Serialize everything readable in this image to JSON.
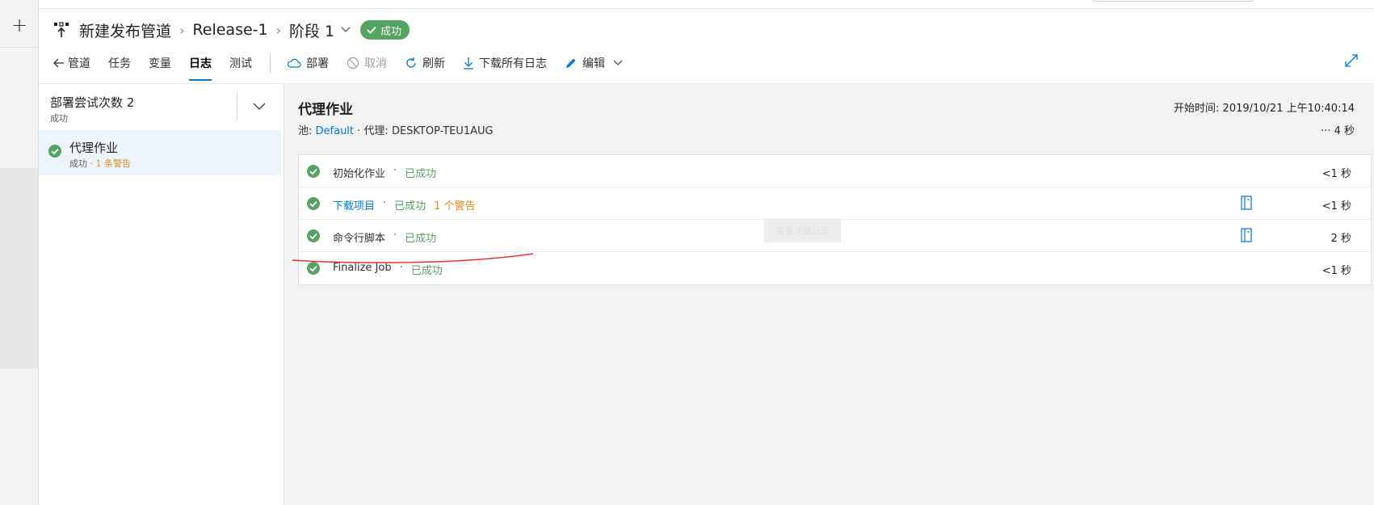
{
  "header": {
    "pipeline": "新建发布管道",
    "release": "Release-1",
    "stage": "阶段 1",
    "status": "成功"
  },
  "tabs": [
    "管道",
    "任务",
    "变量",
    "日志",
    "测试"
  ],
  "active_tab": "日志",
  "tools": {
    "deploy": "部署",
    "cancel": "取消",
    "refresh": "刷新",
    "download_logs": "下载所有日志",
    "edit": "编辑"
  },
  "left": {
    "attempt_title": "部署尝试次数 2",
    "attempt_status": "成功",
    "job_name": "代理作业",
    "job_status": "成功 · ",
    "job_warning": "1 条警告"
  },
  "job": {
    "title": "代理作业",
    "pool_label": "池: ",
    "pool": "Default",
    "agent_label": " · 代理: ",
    "agent": "DESKTOP-TEU1AUG",
    "start_time": "开始时间: 2019/10/21 上午10:40:14",
    "duration": "··· 4 秒"
  },
  "steps": [
    {
      "name": "初始化作业",
      "status": "已成功",
      "warning": "",
      "duration": "<1 秒"
    },
    {
      "name": "下载项目",
      "status": "已成功",
      "warning": "1 个警告",
      "duration": "<1 秒"
    },
    {
      "name": "命令行脚本",
      "status": "已成功",
      "warning": "",
      "duration": "2 秒"
    },
    {
      "name": "Finalize Job",
      "status": "已成功",
      "warning": "",
      "duration": "<1 秒"
    }
  ],
  "tooltip": "查看详细日志",
  "colors": {
    "success": "#55a362",
    "link": "#0078d4",
    "warning": "#d98e1c",
    "annotation": "#e0353b"
  }
}
